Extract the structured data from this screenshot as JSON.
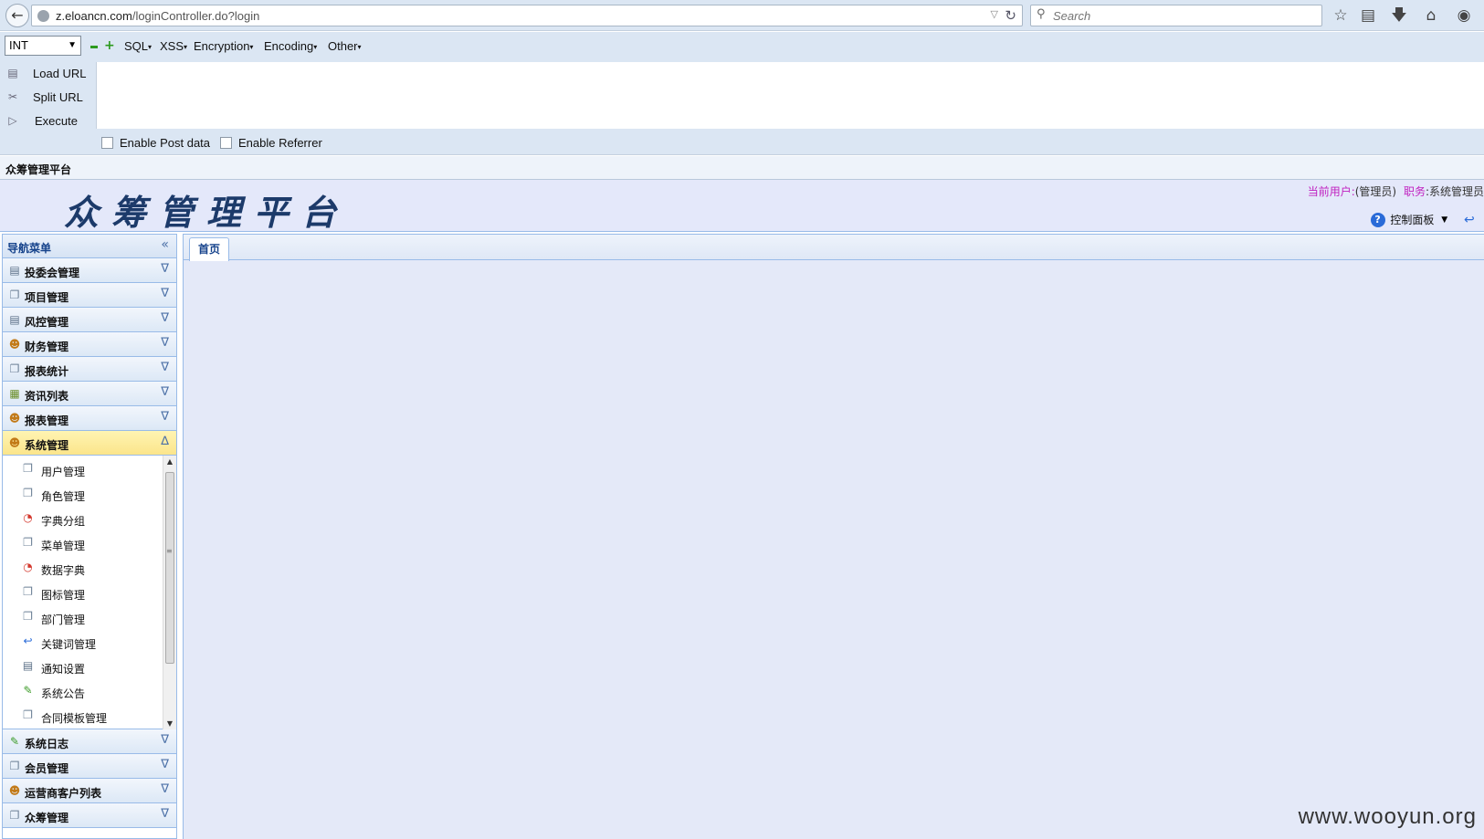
{
  "browser": {
    "url_host": "z.eloancn.com",
    "url_path": "/loginController.do?login",
    "search_placeholder": "Search"
  },
  "hackbar": {
    "type_select": "INT",
    "menus": [
      "SQL",
      "XSS",
      "Encryption",
      "Encoding",
      "Other"
    ],
    "actions": [
      "Load URL",
      "Split URL",
      "Execute"
    ],
    "checkboxes": [
      "Enable Post data",
      "Enable Referrer"
    ]
  },
  "page_tab_title": "众筹管理平台",
  "header": {
    "logo_text": "众筹管理平台",
    "current_user_label": "当前用户:",
    "current_user_value": "(管理员)",
    "role_label": "职务",
    "role_value": ":系统管理员",
    "control_panel_label": "控制面板"
  },
  "sidebar": {
    "title": "导航菜单",
    "groups_top": [
      {
        "label": "投委会管理",
        "icon": "page-icon"
      },
      {
        "label": "项目管理",
        "icon": "pages-icon"
      },
      {
        "label": "风控管理",
        "icon": "calendar-icon"
      },
      {
        "label": "财务管理",
        "icon": "users-icon"
      },
      {
        "label": "报表统计",
        "icon": "pages-icon"
      },
      {
        "label": "资讯列表",
        "icon": "chart-icon"
      },
      {
        "label": "报表管理",
        "icon": "users-icon"
      }
    ],
    "active_group": {
      "label": "系统管理",
      "icon": "users-icon"
    },
    "sub_items": [
      {
        "label": "用户管理",
        "icon": "pages-icon"
      },
      {
        "label": "角色管理",
        "icon": "pages-icon"
      },
      {
        "label": "字典分组",
        "icon": "pie-icon"
      },
      {
        "label": "菜单管理",
        "icon": "pages-icon"
      },
      {
        "label": "数据字典",
        "icon": "pie-icon"
      },
      {
        "label": "图标管理",
        "icon": "pages-icon"
      },
      {
        "label": "部门管理",
        "icon": "pages-icon"
      },
      {
        "label": "关键词管理",
        "icon": "back-icon"
      },
      {
        "label": "通知设置",
        "icon": "calendar-icon"
      },
      {
        "label": "系统公告",
        "icon": "pencil-icon"
      },
      {
        "label": "合同模板管理",
        "icon": "pages-icon"
      }
    ],
    "groups_bottom": [
      {
        "label": "系统日志",
        "icon": "pencil-icon"
      },
      {
        "label": "会员管理",
        "icon": "pages-icon"
      },
      {
        "label": "运营商客户列表",
        "icon": "users-icon"
      },
      {
        "label": "众筹管理",
        "icon": "pages-icon"
      }
    ]
  },
  "main": {
    "tabs": [
      "首页"
    ]
  },
  "watermark": "www.wooyun.org"
}
